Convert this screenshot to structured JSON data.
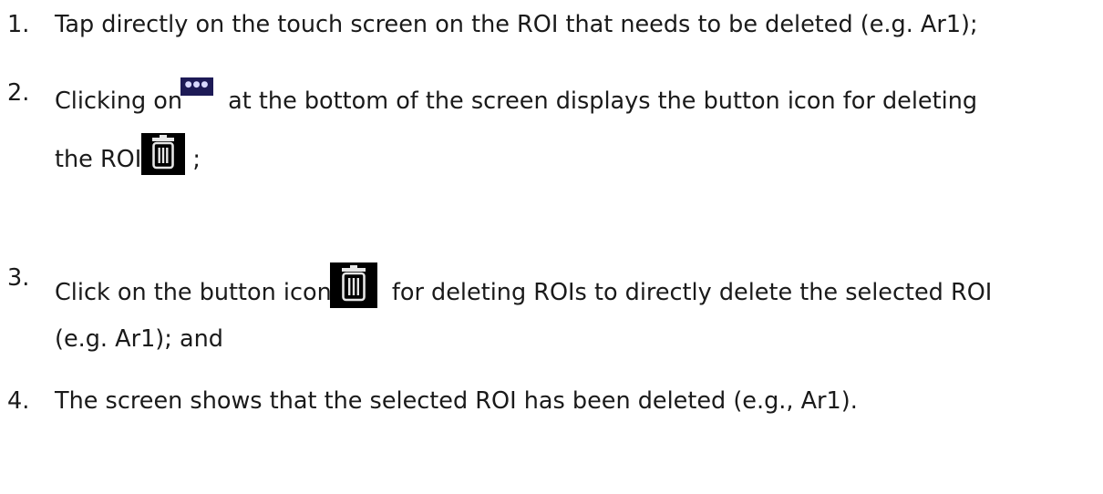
{
  "steps": [
    {
      "number": "1.",
      "text": "Tap directly on the touch screen on the ROI that needs to be deleted (e.g. Ar1);"
    },
    {
      "number": "2.",
      "text_before_icon": "Clicking on",
      "text_after_icon": " at the bottom of the screen displays the button icon for deleting",
      "continuation_before_icon": "the ROI",
      "continuation_after_icon": " ;",
      "icons": [
        "more-options-icon",
        "trash-icon"
      ]
    },
    {
      "number": "3.",
      "text_before_icon": "Click on the button icon",
      "text_after_icon": " for deleting ROIs to directly delete the selected ROI",
      "continuation": "(e.g. Ar1); and",
      "icons": [
        "trash-icon"
      ]
    },
    {
      "number": "4.",
      "text": "The screen shows that the selected ROI has been deleted (e.g., Ar1)."
    }
  ],
  "colors": {
    "text": "#1a1a1a",
    "more_button_bg": "#1d1a56",
    "trash_button_bg": "#000000",
    "trash_glyph": "#e6e6e6"
  }
}
